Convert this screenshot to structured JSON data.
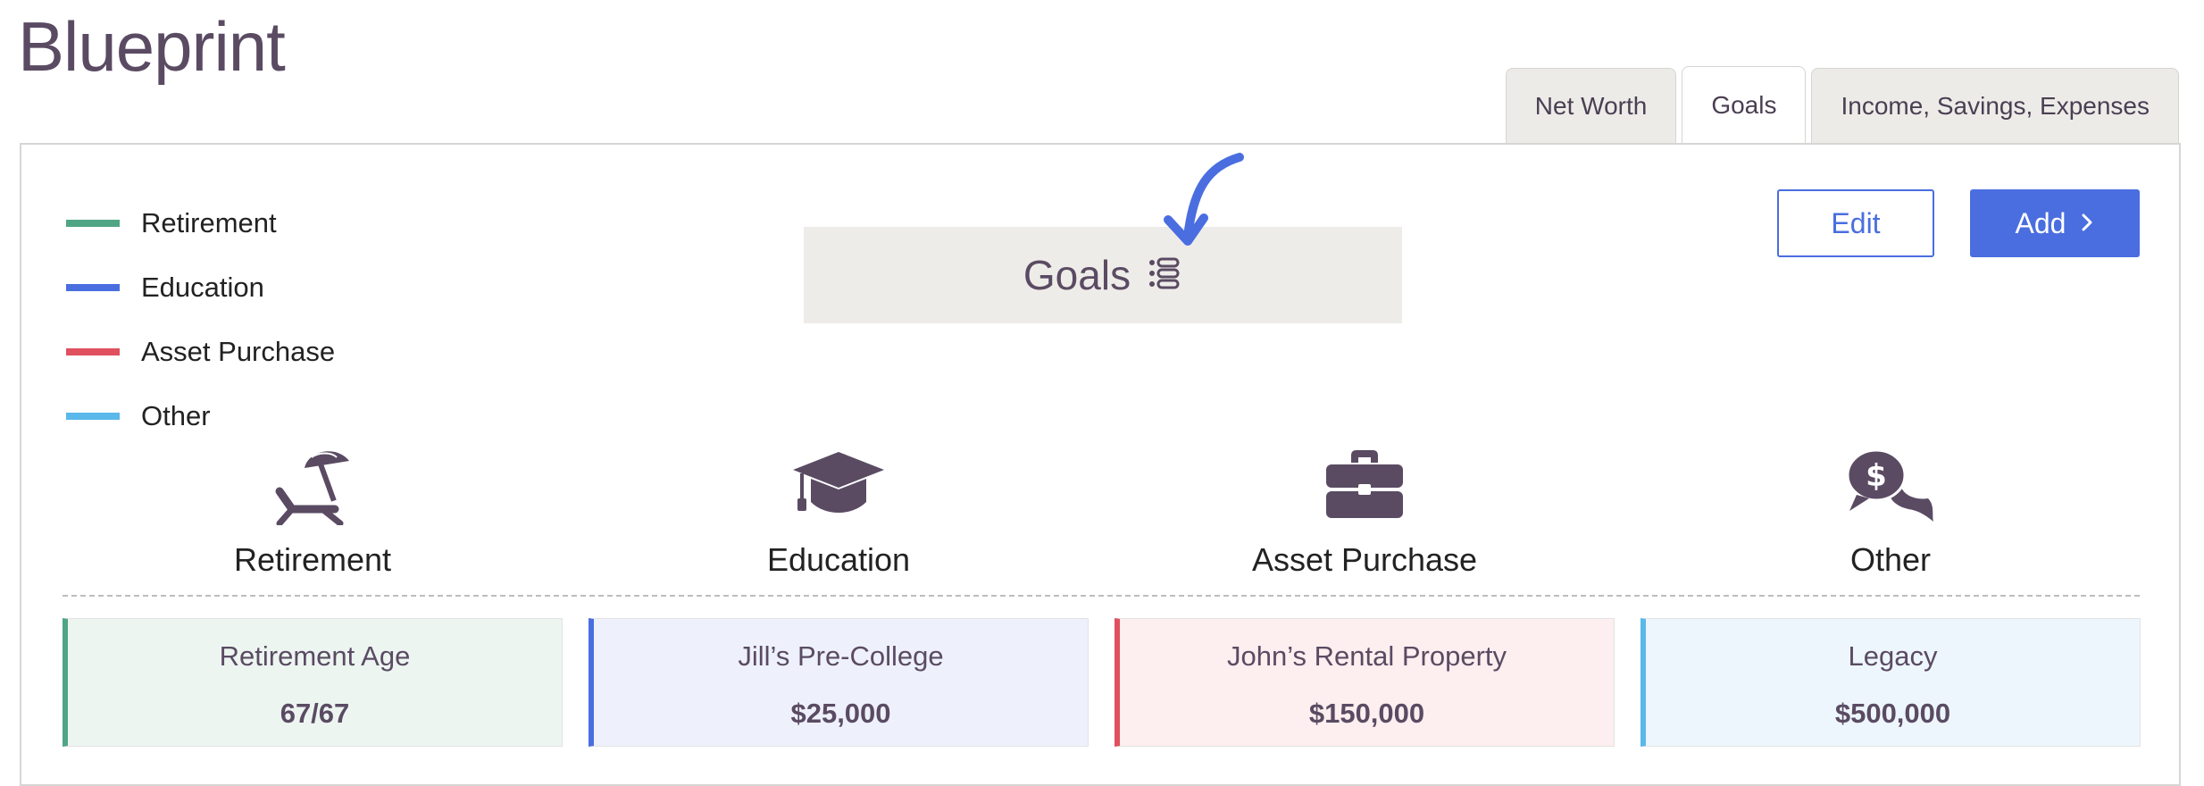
{
  "page": {
    "title": "Blueprint"
  },
  "tabs": [
    {
      "label": "Net Worth",
      "active": false
    },
    {
      "label": "Goals",
      "active": true
    },
    {
      "label": "Income, Savings, Expenses",
      "active": false
    }
  ],
  "legend": [
    {
      "label": "Retirement",
      "color": "#4fa584"
    },
    {
      "label": "Education",
      "color": "#4a6ee0"
    },
    {
      "label": "Asset Purchase",
      "color": "#e0505e"
    },
    {
      "label": "Other",
      "color": "#5ab8ea"
    }
  ],
  "goals_header": {
    "label": "Goals",
    "icon": "list-icon"
  },
  "buttons": {
    "edit_label": "Edit",
    "add_label": "Add",
    "add_icon": "chevron-right-icon"
  },
  "categories": [
    {
      "label": "Retirement",
      "icon": "beach-chair-icon"
    },
    {
      "label": "Education",
      "icon": "graduation-cap-icon"
    },
    {
      "label": "Asset Purchase",
      "icon": "briefcase-icon"
    },
    {
      "label": "Other",
      "icon": "dollar-chat-icon"
    }
  ],
  "cards": [
    {
      "title": "Retirement Age",
      "value": "67/67",
      "color": "#4fa584",
      "bg": "#edf5f1"
    },
    {
      "title": "Jill’s Pre-College",
      "value": "$25,000",
      "color": "#4a6ee0",
      "bg": "#eef1fb"
    },
    {
      "title": "John’s Rental Property",
      "value": "$150,000",
      "color": "#e0505e",
      "bg": "#fdeeef"
    },
    {
      "title": "Legacy",
      "value": "$500,000",
      "color": "#5ab8ea",
      "bg": "#eef6fd"
    }
  ]
}
